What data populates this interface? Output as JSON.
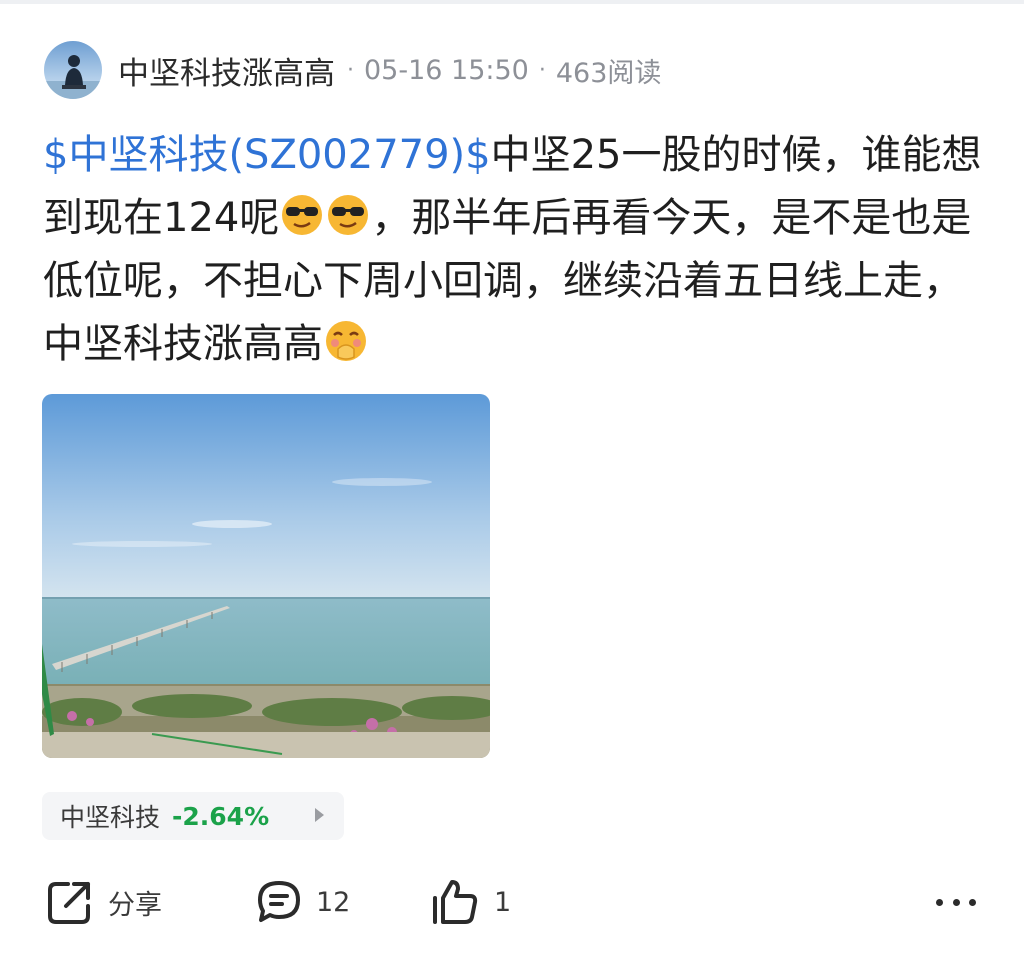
{
  "post": {
    "author": "中坚科技涨高高",
    "time": "05-16 15:50",
    "reads": "463阅读",
    "separator": "·",
    "stock_link": "$中坚科技(SZ002779)$",
    "text_1": "中坚25一股的时候，谁能想到现在124呢",
    "text_2": "，那半年后再看今天，是不是也是低位呢，不担心下周小回调，继续沿着五日线上走，中坚科技涨高高",
    "emojis": [
      "sunglasses-face",
      "sunglasses-face",
      "hand-over-mouth-face"
    ]
  },
  "stock_chip": {
    "name": "中坚科技",
    "change": "-2.64%",
    "change_color": "#1ba24a"
  },
  "actions": {
    "share_label": "分享",
    "comment_count": "12",
    "like_count": "1"
  },
  "colors": {
    "link": "#2f73d6",
    "text": "#1f1f1f",
    "meta": "#8d9097"
  }
}
